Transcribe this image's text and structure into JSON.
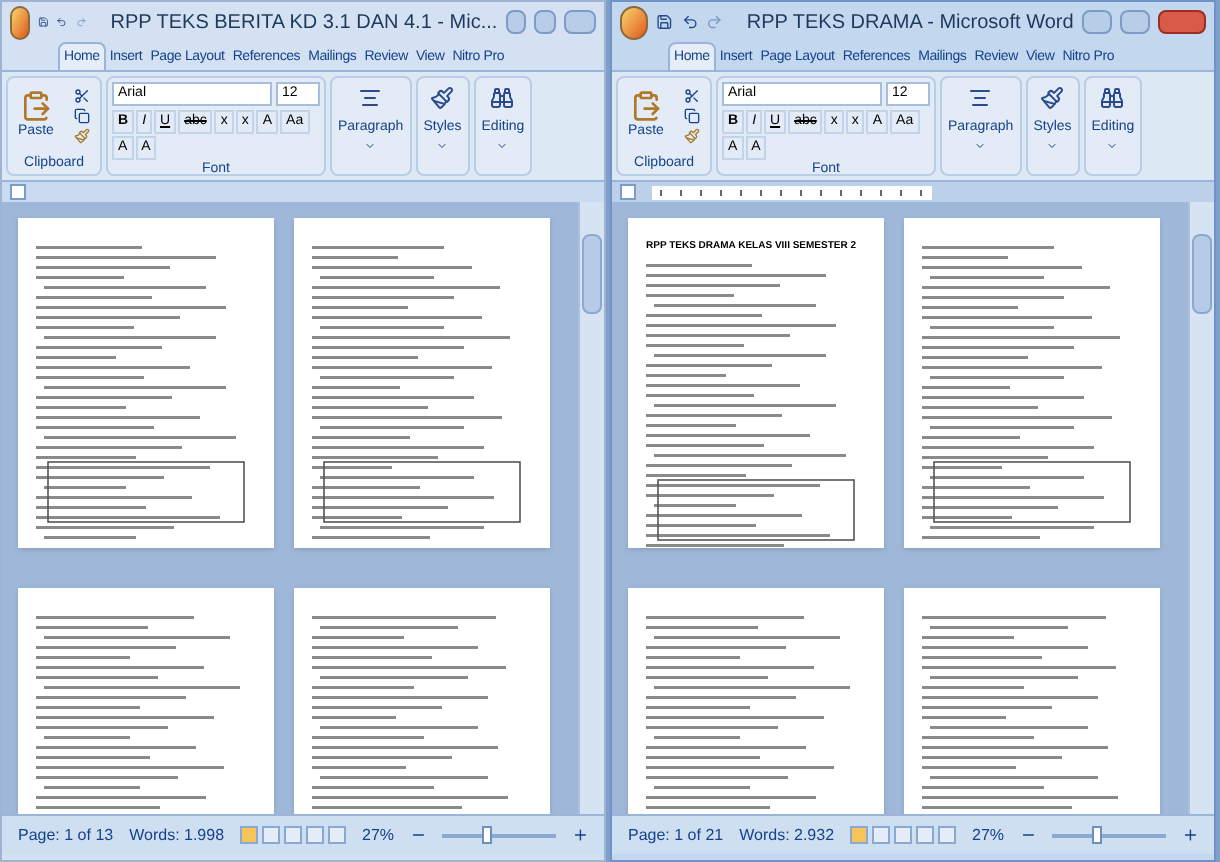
{
  "windows": [
    {
      "title": "RPP TEKS BERITA KD 3.1 DAN 4.1 - Mic...",
      "active": false,
      "tabs": [
        {
          "label": "Home",
          "selected": true
        },
        {
          "label": "Insert",
          "selected": false
        },
        {
          "label": "Page Layout",
          "selected": false
        },
        {
          "label": "References",
          "selected": false
        },
        {
          "label": "Mailings",
          "selected": false
        },
        {
          "label": "Review",
          "selected": false
        },
        {
          "label": "View",
          "selected": false
        },
        {
          "label": "Nitro Pro",
          "selected": false
        }
      ],
      "font_name": "Arial",
      "font_size": "12",
      "format_buttons": [
        "B",
        "I",
        "U",
        "abc",
        "x",
        "x",
        "A",
        "Aa",
        "A",
        "A"
      ],
      "groups": {
        "paste": "Paste",
        "clipboard": "Clipboard",
        "font": "Font",
        "paragraph": "Paragraph",
        "styles": "Styles",
        "editing": "Editing"
      },
      "ruler_visible": false,
      "status": {
        "page": "Page: 1 of 13",
        "words": "Words: 1.998",
        "zoom": "27%",
        "zoom_slider": {
          "level": 0.35
        }
      }
    },
    {
      "title": "RPP TEKS DRAMA - Microsoft Word",
      "active": true,
      "tabs": [
        {
          "label": "Home",
          "selected": true
        },
        {
          "label": "Insert",
          "selected": false
        },
        {
          "label": "Page Layout",
          "selected": false
        },
        {
          "label": "References",
          "selected": false
        },
        {
          "label": "Mailings",
          "selected": false
        },
        {
          "label": "Review",
          "selected": false
        },
        {
          "label": "View",
          "selected": false
        },
        {
          "label": "Nitro Pro",
          "selected": false
        }
      ],
      "font_name": "Arial",
      "font_size": "12",
      "format_buttons": [
        "B",
        "I",
        "U",
        "abc",
        "x",
        "x",
        "A",
        "Aa",
        "A",
        "A"
      ],
      "groups": {
        "paste": "Paste",
        "clipboard": "Clipboard",
        "font": "Font",
        "paragraph": "Paragraph",
        "styles": "Styles",
        "editing": "Editing"
      },
      "ruler_visible": true,
      "first_page_heading": "RPP TEKS DRAMA KELAS VIII SEMESTER 2",
      "status": {
        "page": "Page: 1 of 21",
        "words": "Words: 2.932",
        "zoom": "27%",
        "zoom_slider": {
          "level": 0.35
        }
      }
    }
  ]
}
